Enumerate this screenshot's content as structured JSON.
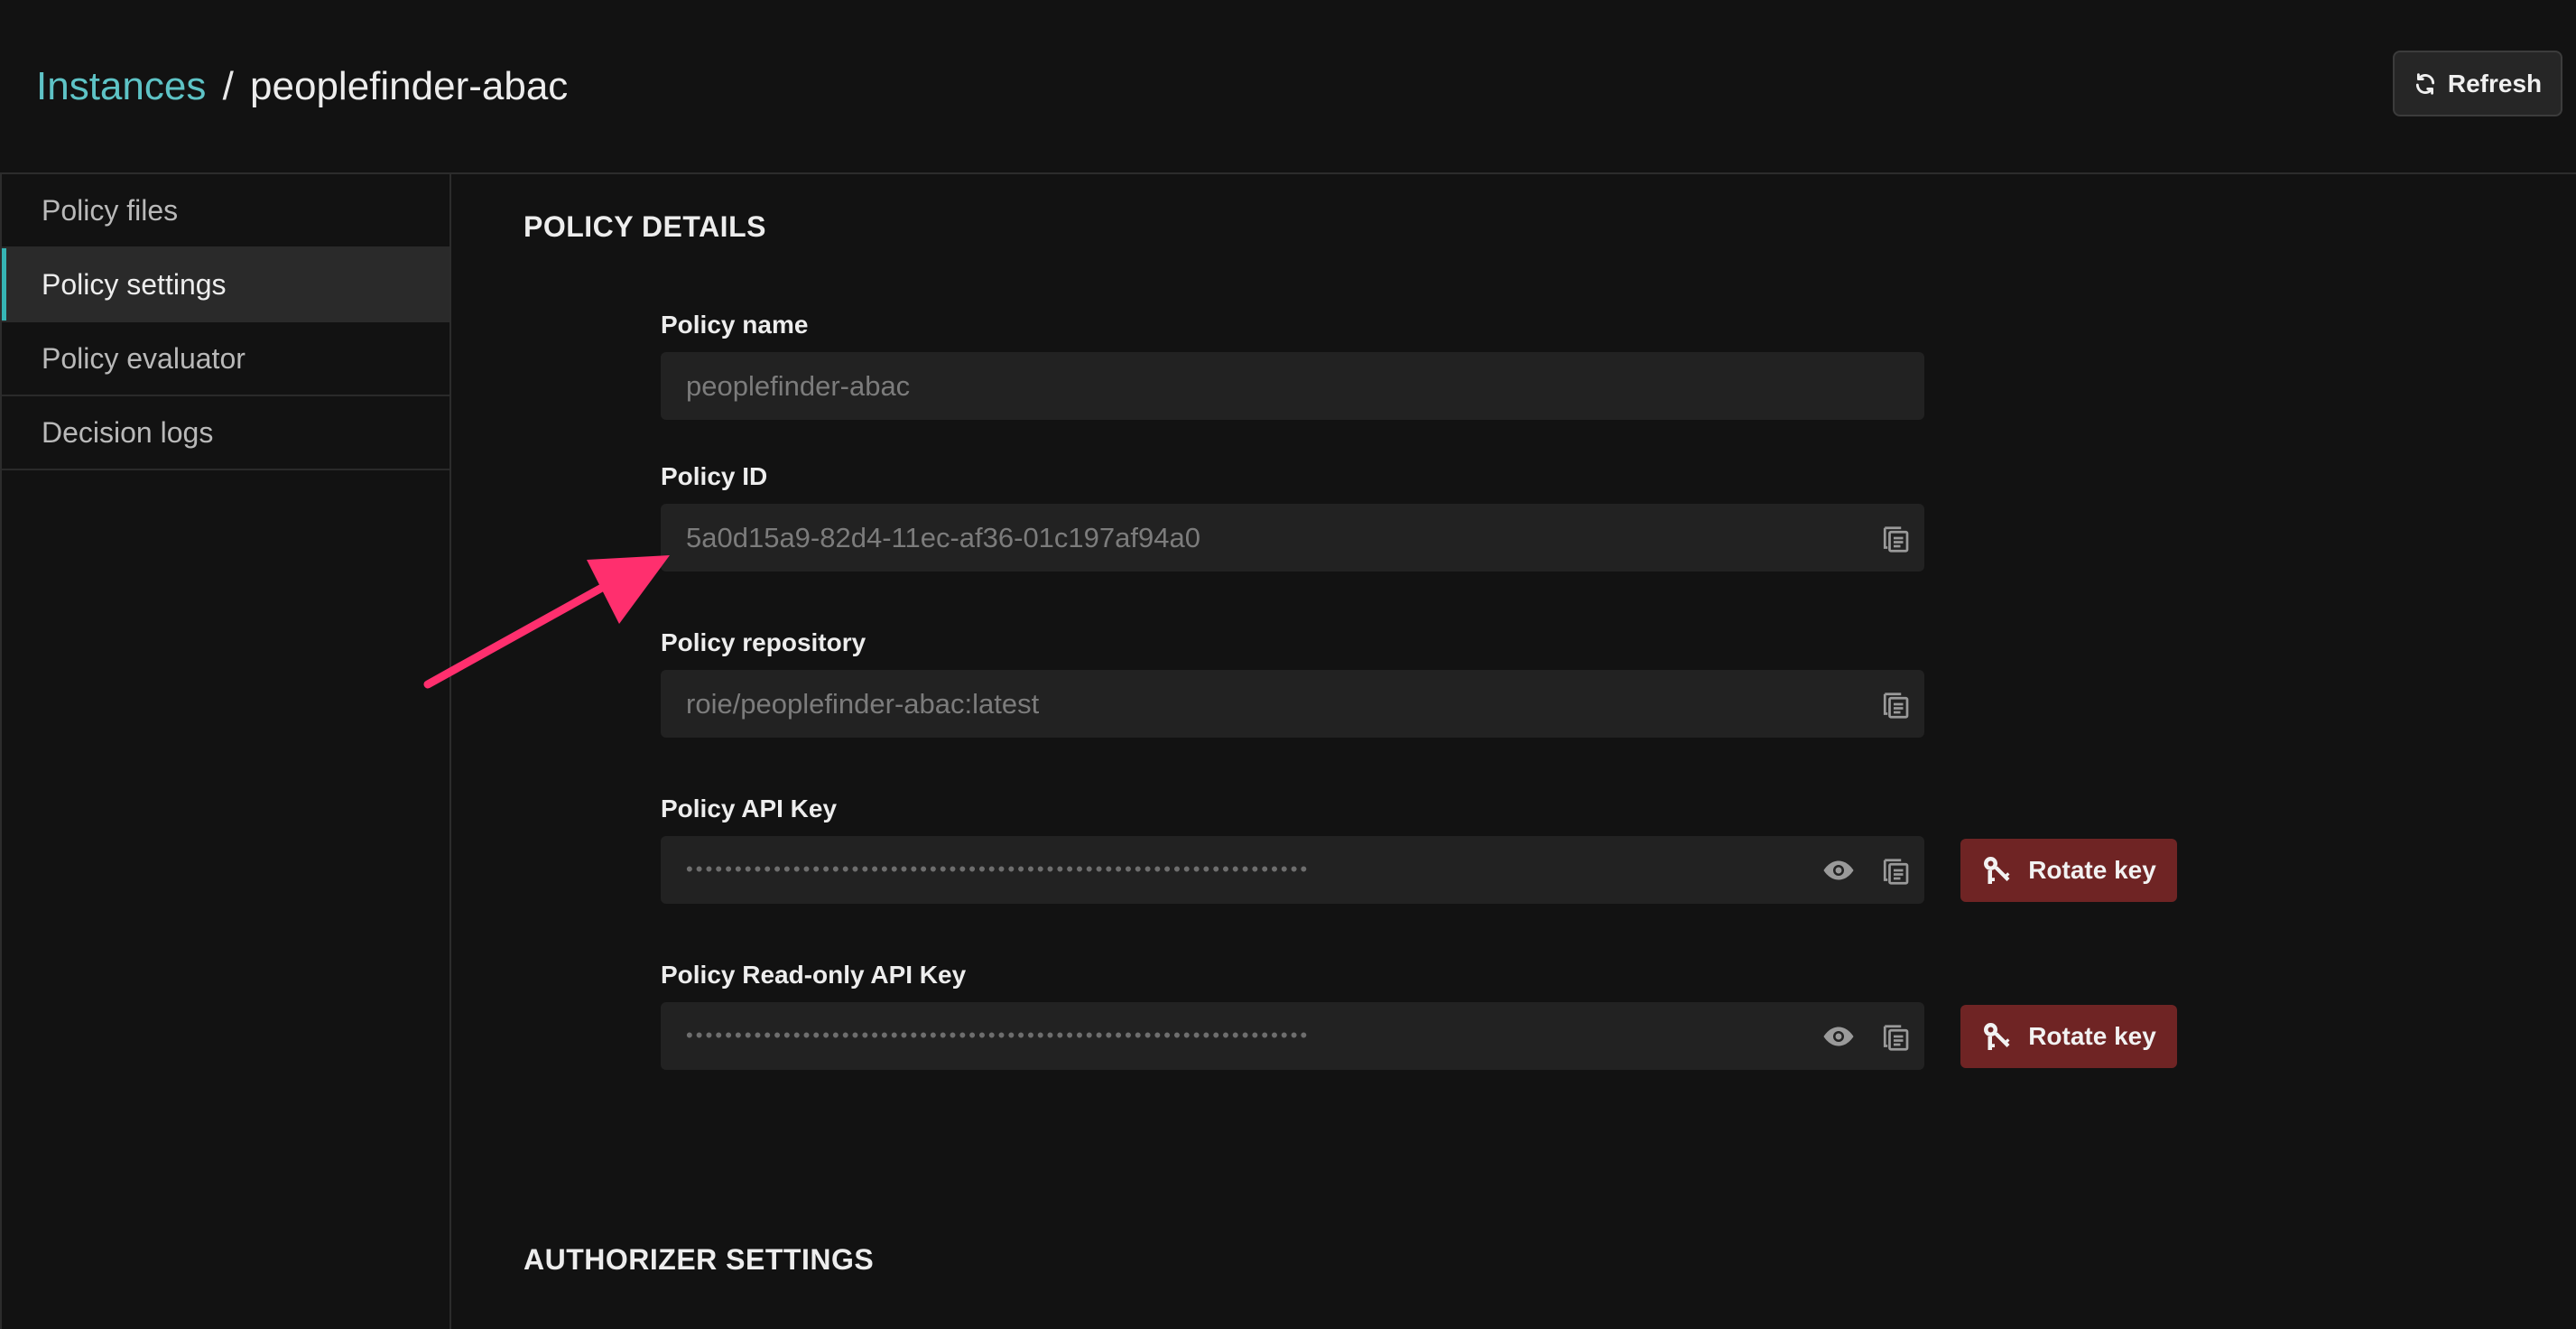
{
  "header": {
    "breadcrumb_root": "Instances",
    "breadcrumb_separator": "/",
    "breadcrumb_current": "peoplefinder-abac",
    "refresh_label": "Refresh"
  },
  "sidebar": {
    "items": [
      {
        "label": "Policy files",
        "active": false
      },
      {
        "label": "Policy settings",
        "active": true
      },
      {
        "label": "Policy evaluator",
        "active": false
      },
      {
        "label": "Decision logs",
        "active": false
      }
    ]
  },
  "policy_details": {
    "title": "POLICY DETAILS",
    "policy_name": {
      "label": "Policy name",
      "value": "peoplefinder-abac"
    },
    "policy_id": {
      "label": "Policy ID",
      "value": "5a0d15a9-82d4-11ec-af36-01c197af94a0"
    },
    "policy_repository": {
      "label": "Policy repository",
      "value": "roie/peoplefinder-abac:latest"
    },
    "api_key": {
      "label": "Policy API Key",
      "masked": "••••••••••••••••••••••••••••••••••••••••••••••••••••••••••••••••",
      "rotate_label": "Rotate key"
    },
    "readonly_api_key": {
      "label": "Policy Read-only API Key",
      "masked": "••••••••••••••••••••••••••••••••••••••••••••••••••••••••••••••••",
      "rotate_label": "Rotate key"
    }
  },
  "authorizer_settings": {
    "title": "AUTHORIZER SETTINGS"
  },
  "colors": {
    "background": "#121212",
    "accent_teal": "#5ec3c6",
    "rotate_button": "#6f2424",
    "annotation_arrow": "#ff2f6e"
  },
  "icons": {
    "refresh": "refresh-icon",
    "copy": "copy-icon",
    "eye": "eye-icon",
    "key": "keys-icon"
  }
}
